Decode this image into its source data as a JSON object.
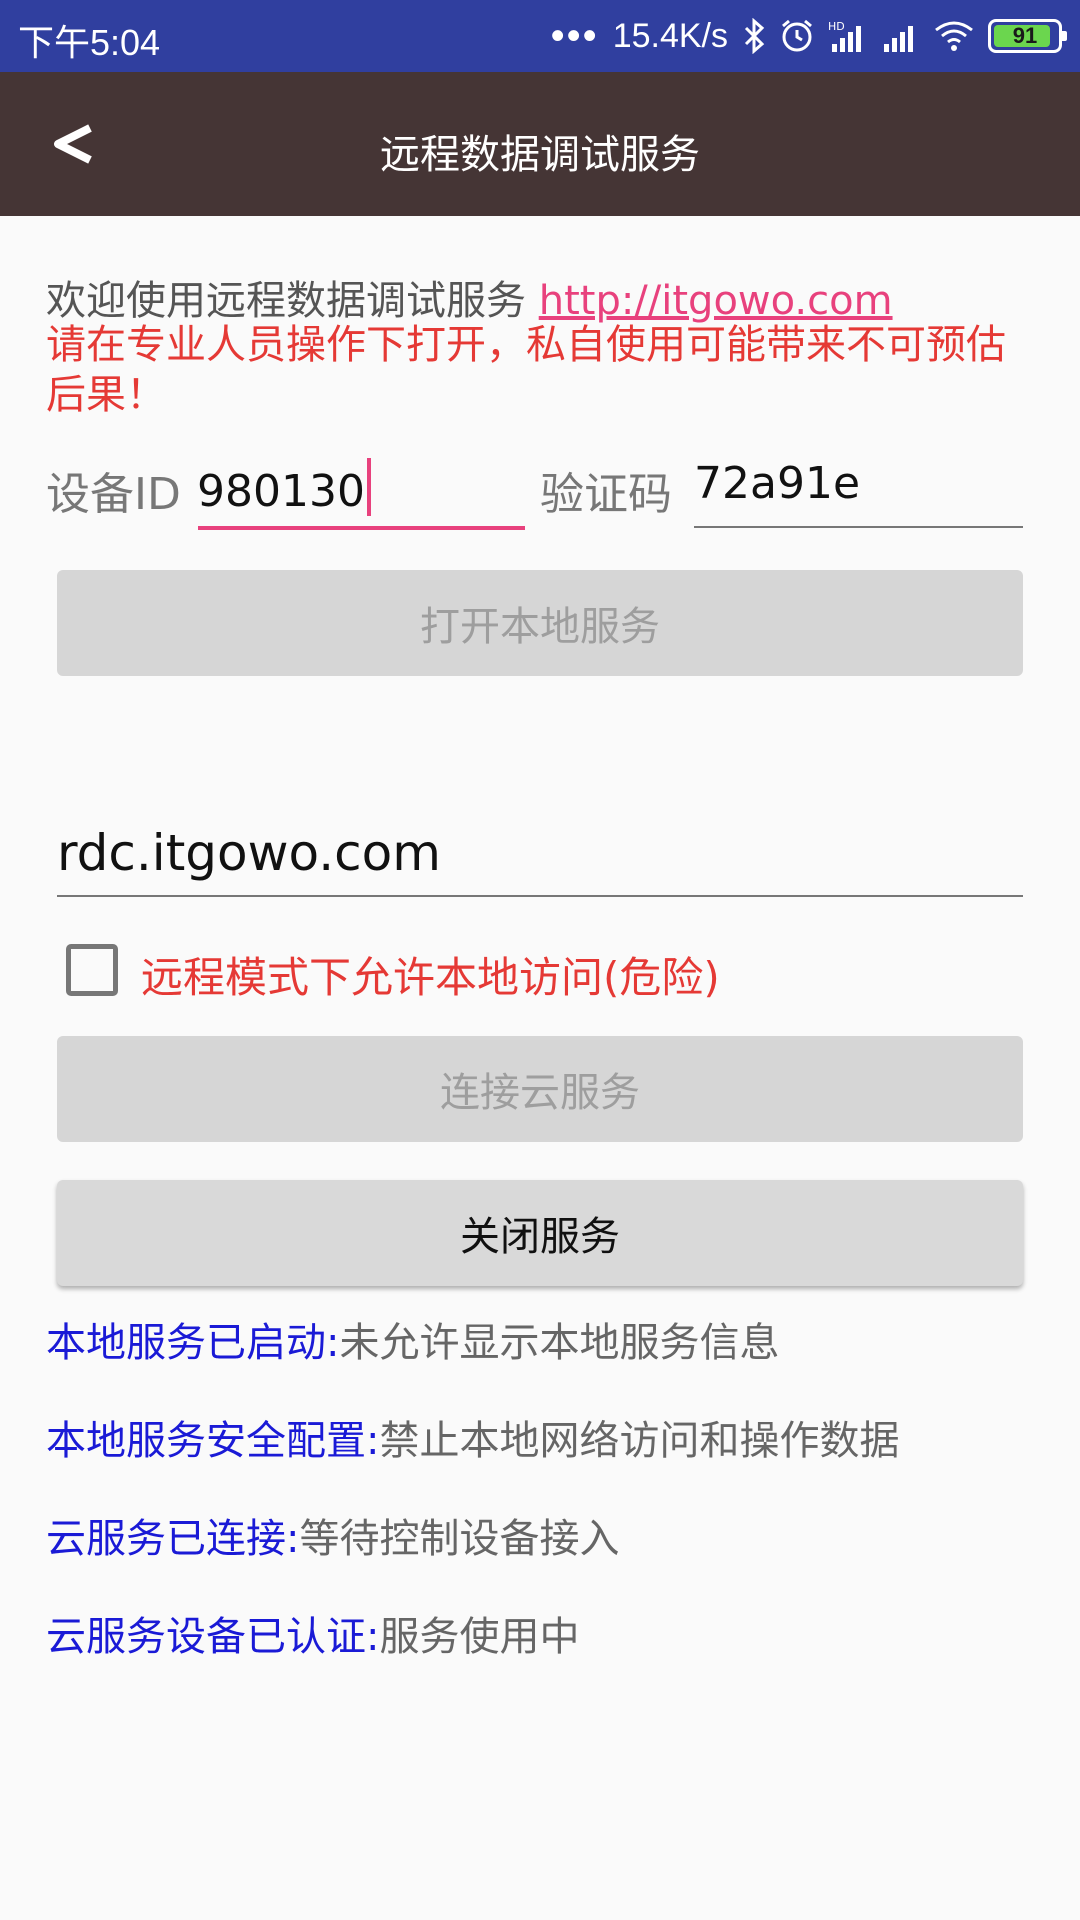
{
  "status_bar": {
    "time": "下午5:04",
    "network_speed": "15.4K/s",
    "battery_level": "91",
    "icons": [
      "dots-icon",
      "bluetooth-icon",
      "alarm-icon",
      "hd-signal-icon",
      "signal-icon",
      "wifi-icon",
      "battery-icon"
    ]
  },
  "app_bar": {
    "title": "远程数据调试服务",
    "back_icon": "back-arrow-icon"
  },
  "intro": {
    "welcome_text": "欢迎使用远程数据调试服务 ",
    "link_text": "http://itgowo.com",
    "warning": "请在专业人员操作下打开，私自使用可能带来不可预估后果！"
  },
  "device": {
    "id_label": "设备ID",
    "id_value": "980130",
    "code_label": "验证码",
    "code_value": "72a91e"
  },
  "buttons": {
    "open_local": "打开本地服务",
    "connect_cloud": "连接云服务",
    "close_service": "关闭服务"
  },
  "server": {
    "host": "rdc.itgowo.com"
  },
  "checkbox": {
    "label": "远程模式下允许本地访问(危险)",
    "checked": false
  },
  "status_lines": [
    {
      "key": "本地服务已启动:",
      "value": "未允许显示本地服务信息"
    },
    {
      "key": "本地服务安全配置:",
      "value": "禁止本地网络访问和操作数据"
    },
    {
      "key": "云服务已连接:",
      "value": "等待控制设备接入"
    },
    {
      "key": "云服务设备已认证:",
      "value": "服务使用中"
    }
  ],
  "colors": {
    "status_bar": "#303f9f",
    "app_bar": "#453535",
    "accent": "#e8417d",
    "warning": "#e53935",
    "status_key": "#1a1ad6"
  }
}
